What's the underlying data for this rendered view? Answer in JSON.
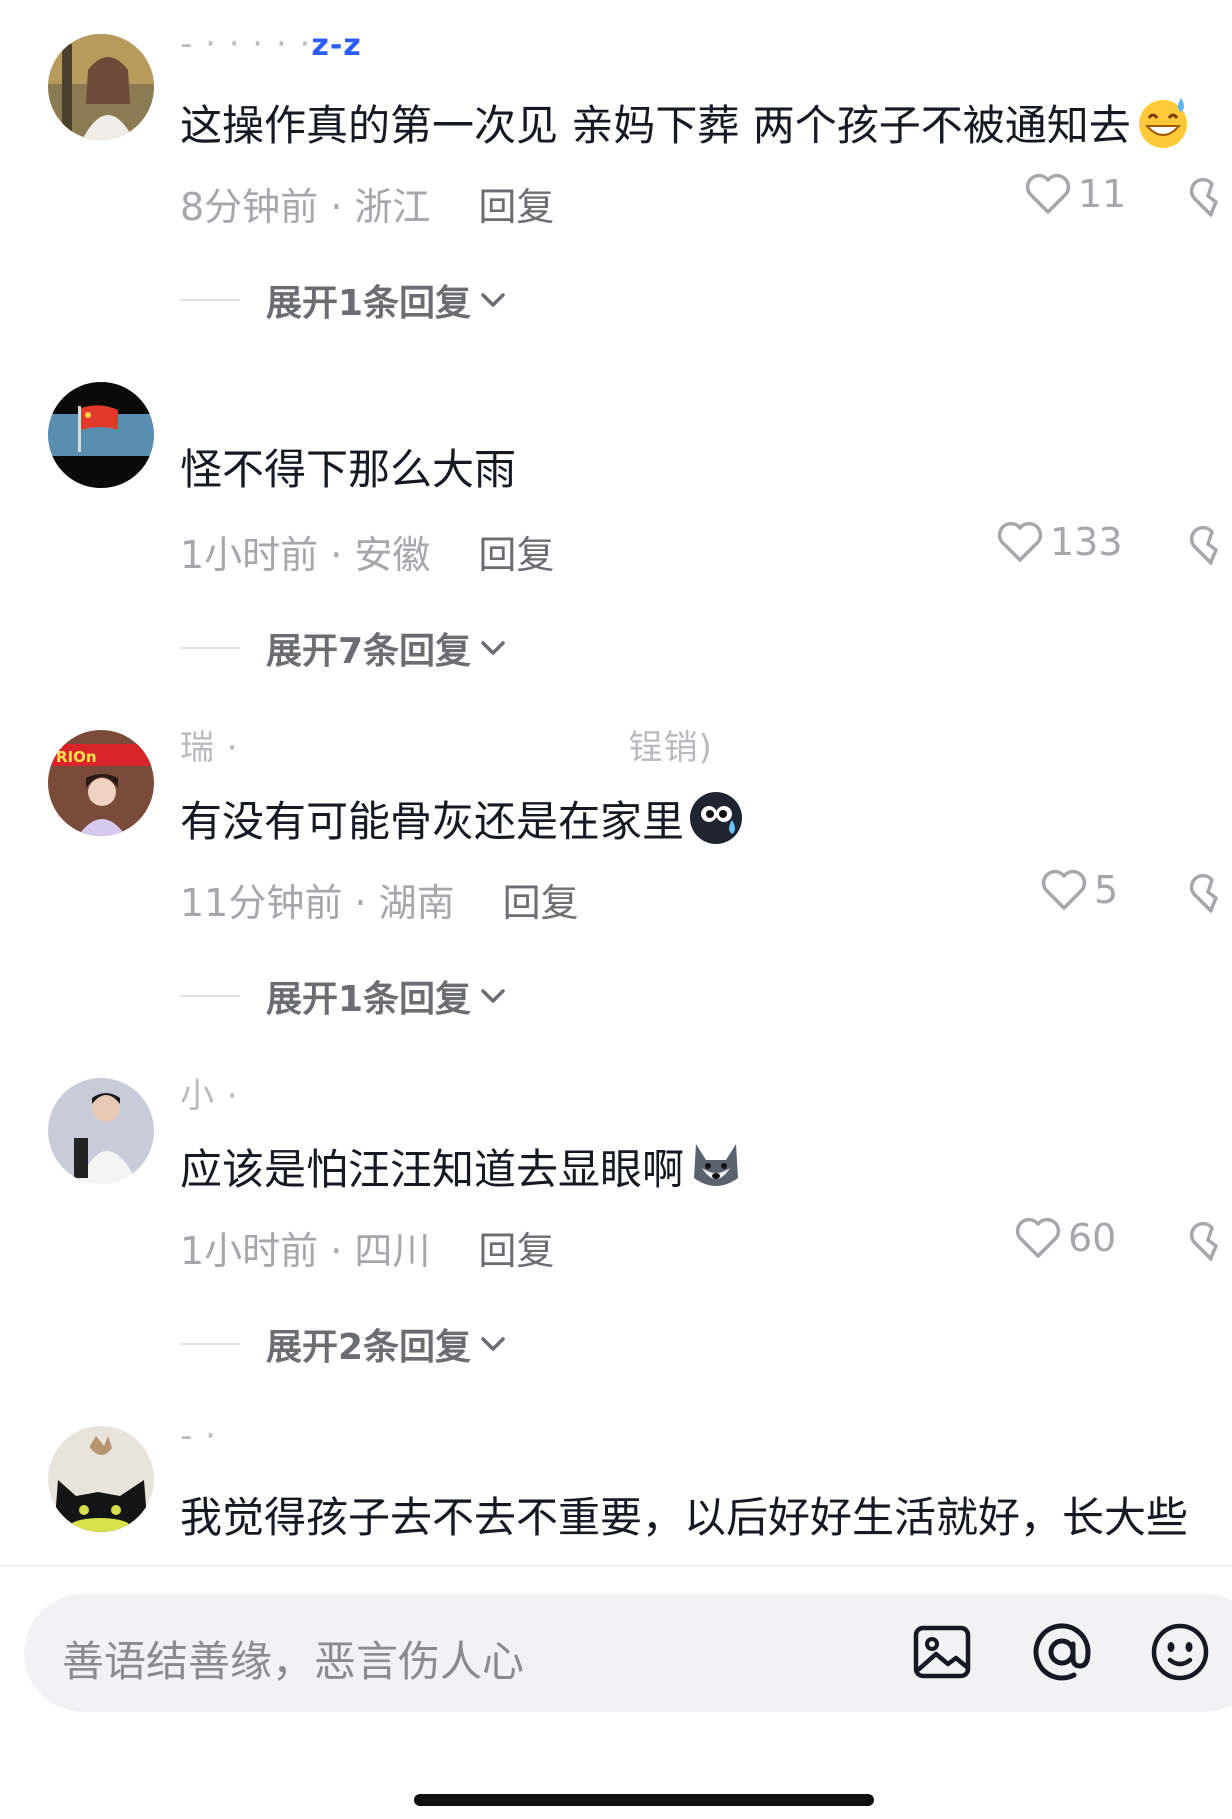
{
  "comments": [
    {
      "username": "- · · · · ·",
      "username_mark": "z-z",
      "text": "这操作真的第一次见 亲妈下葬 两个孩子不被通知去",
      "emoji": "grinning-sweat-emoji",
      "time_location": "8分钟前 · 浙江",
      "reply_label": "回复",
      "likes": "11",
      "expand_label": "展开1条回复"
    },
    {
      "username": "",
      "text": "怪不得下那么大雨",
      "time_location": "1小时前 · 安徽",
      "reply_label": "回复",
      "likes": "133",
      "expand_label": "展开7条回复"
    },
    {
      "username": "瑞 ·",
      "username_suffix": "锃销)",
      "text": "有没有可能骨灰还是在家里",
      "emoji": "sweat-face-emoji",
      "time_location": "11分钟前 · 湖南",
      "reply_label": "回复",
      "likes": "5",
      "expand_label": "展开1条回复"
    },
    {
      "username": "小 ·",
      "text": "应该是怕汪汪知道去显眼啊",
      "emoji": "husky-dog-emoji",
      "time_location": "1小时前 · 四川",
      "reply_label": "回复",
      "likes": "60",
      "expand_label": "展开2条回复"
    },
    {
      "username": "- ·",
      "text": "我觉得孩子去不去不重要，以后好好生活就好，长大些"
    }
  ],
  "input": {
    "placeholder": "善语结善缘，恶言伤人心"
  },
  "icons": {
    "image": "image-icon",
    "mention": "at-icon",
    "emoji": "emoji-icon",
    "like": "heart-icon",
    "dislike": "broken-heart-icon"
  }
}
